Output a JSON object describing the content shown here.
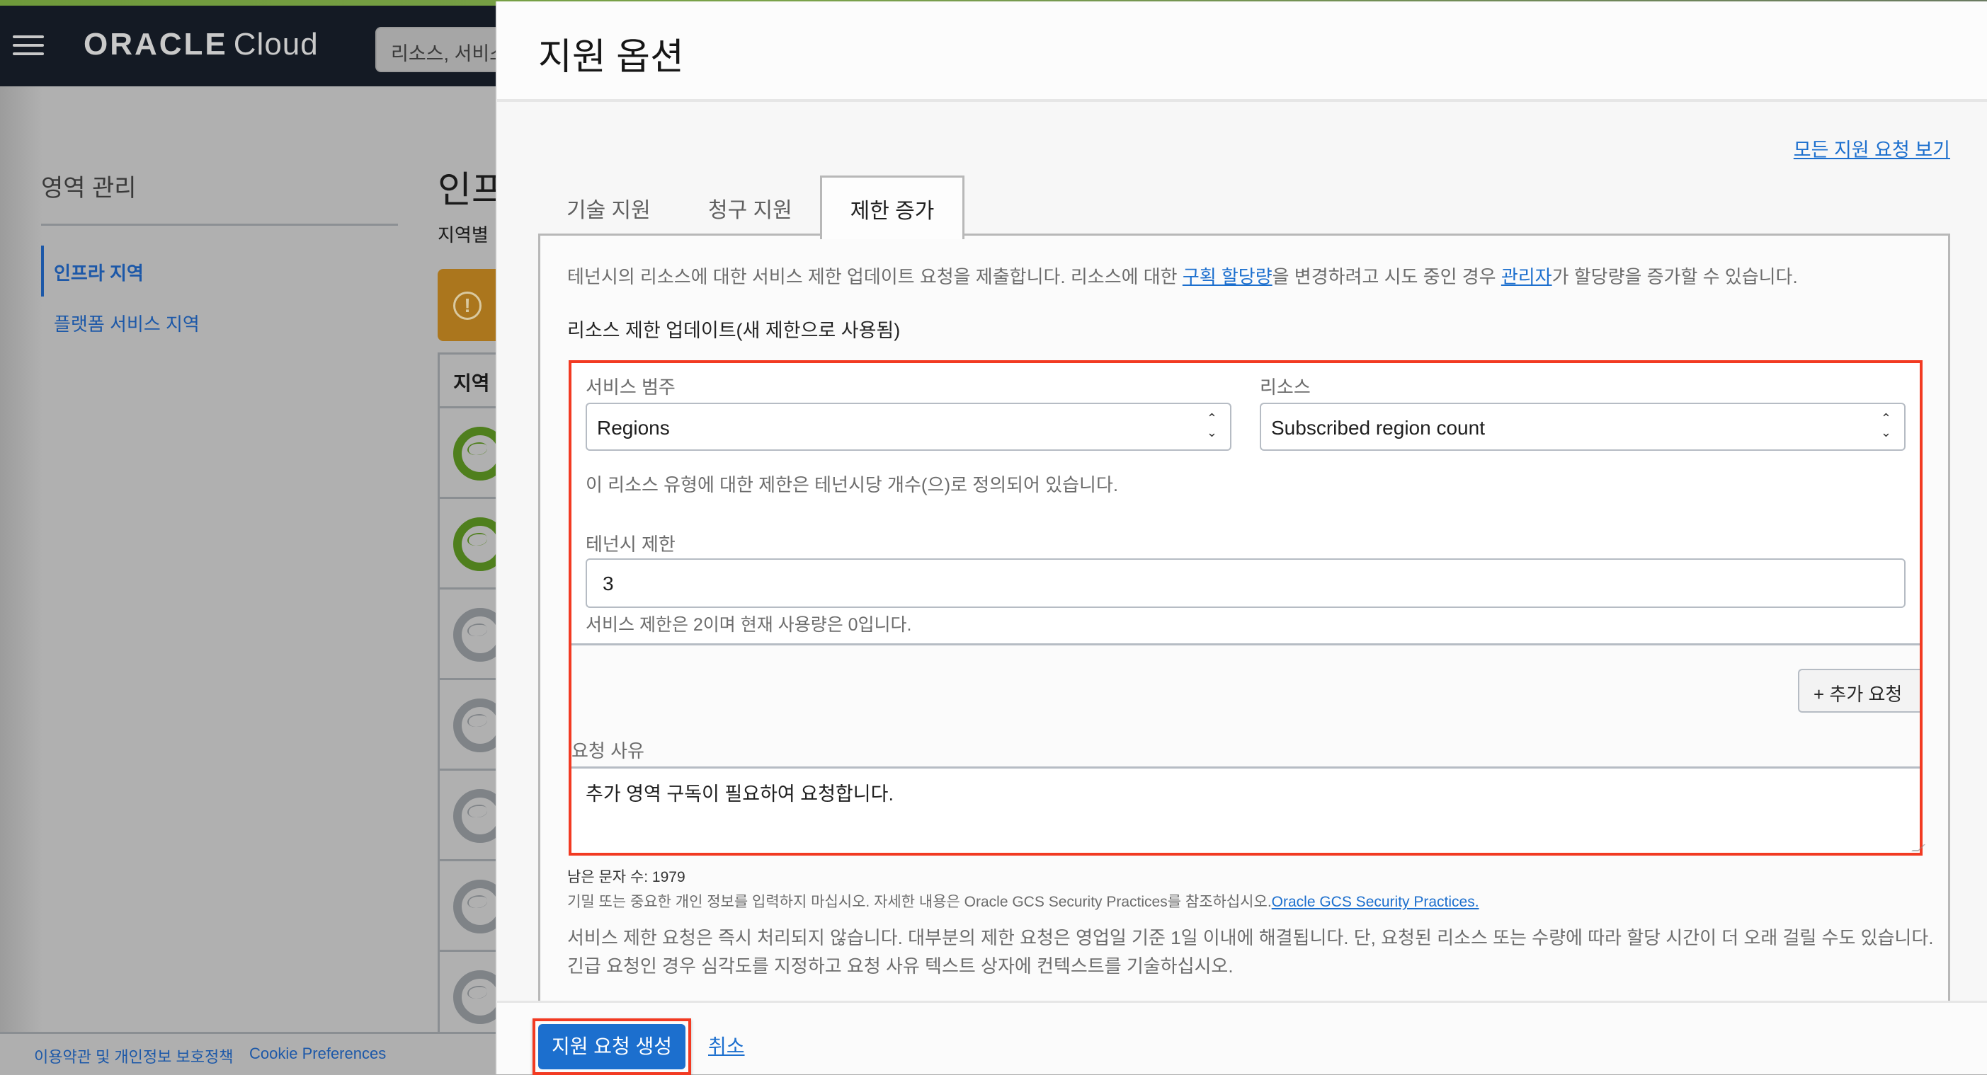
{
  "background": {
    "header": {
      "logo_brand": "ORACLE",
      "logo_product": "Cloud",
      "search_placeholder": "리소스, 서비스"
    },
    "sidebar": {
      "title": "영역 관리",
      "items": [
        {
          "label": "인프라 지역",
          "active": true
        },
        {
          "label": "플랫폼 서비스 지역",
          "active": false
        }
      ]
    },
    "page": {
      "title": "인프",
      "subtitle": "지역별",
      "table_header": "지역",
      "region_rows": [
        {
          "status": "subscribed"
        },
        {
          "status": "subscribed"
        },
        {
          "status": "unsubscribed"
        },
        {
          "status": "unsubscribed"
        },
        {
          "status": "unsubscribed"
        },
        {
          "status": "unsubscribed"
        },
        {
          "status": "unsubscribed"
        }
      ]
    },
    "footer": {
      "terms": "이용약관 및 개인정보 보호정책",
      "cookie": "Cookie Preferences"
    }
  },
  "panel": {
    "title": "지원 옵션",
    "view_all_link": "모든 지원 요청 보기",
    "tabs": [
      {
        "label": "기술 지원",
        "active": false
      },
      {
        "label": "청구 지원",
        "active": false
      },
      {
        "label": "제한 증가",
        "active": true
      }
    ],
    "intro": {
      "part1": "테넌시의 리소스에 대한 서비스 제한 업데이트 요청을 제출합니다. 리소스에 대한 ",
      "link1": "구획 할당량",
      "part2": "을 변경하려고 시도 중인 경우 ",
      "link2": "관리자",
      "part3": "가 할당량을 증가할 수 있습니다."
    },
    "section_title": "리소스 제한 업데이트(새 제한으로 사용됨)",
    "form": {
      "service_category_label": "서비스 범주",
      "service_category_value": "Regions",
      "resource_label": "리소스",
      "resource_value": "Subscribed region count",
      "unit_hint": "이 리소스 유형에 대한 제한은 테넌시당 개수(으)로 정의되어 있습니다.",
      "tenancy_limit_label": "테넌시 제한",
      "tenancy_limit_value": "3",
      "current_hint": "서비스 제한은 2이며 현재 사용량은 0입니다.",
      "add_request_label": "+ 추가 요청",
      "reason_label": "요청 사유",
      "reason_value": "추가 영역 구독이 필요하여 요청합니다.",
      "char_count": "남은 문자 수: 1979",
      "privacy_text": "기밀 또는 중요한 개인 정보를 입력하지 마십시오. 자세한 내용은 Oracle GCS Security Practices를 참조하십시오.",
      "privacy_link": "Oracle GCS Security Practices."
    },
    "notice": "서비스 제한 요청은 즉시 처리되지 않습니다. 대부분의 제한 요청은 영업일 기준 1일 이내에 해결됩니다. 단, 요청된 리소스 또는 수량에 따라 할당 시간이 더 오래 걸릴 수도 있습니다. 긴급 요청인 경우 심각도를 지정하고 요청 사유 텍스트 상자에 컨텍스트를 기술하십시오.",
    "footer": {
      "create_button": "지원 요청 생성",
      "cancel_link": "취소"
    }
  },
  "colors": {
    "accent_blue": "#1c6fce",
    "highlight_red": "#f23a22",
    "header_dark": "#141a24",
    "subscribed_green": "#4f7f1d",
    "warning_amber": "#ab761d"
  }
}
